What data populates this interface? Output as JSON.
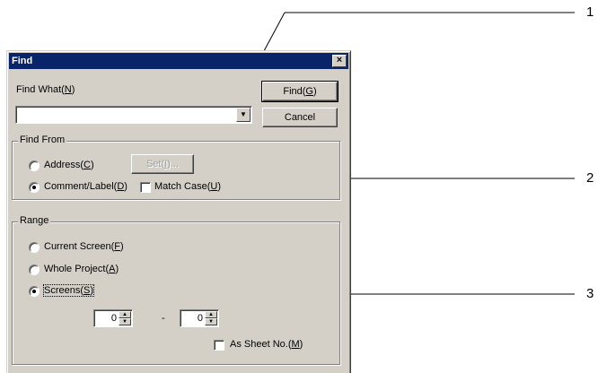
{
  "dialog": {
    "title": "Find",
    "close_glyph": "×",
    "find_what": {
      "label": "Find What(",
      "key": "N",
      "end": ")",
      "value": ""
    },
    "find_button": {
      "label": "Find(",
      "key": "G",
      "end": ")"
    },
    "cancel_button": {
      "label": "Cancel"
    },
    "find_from": {
      "title": "Find From",
      "address": {
        "label": "Address(",
        "key": "C",
        "end": ")",
        "selected": false
      },
      "set_button": {
        "label": "Set(",
        "key": "I",
        "end": ")..."
      },
      "comment": {
        "label": "Comment/Label(",
        "key": "D",
        "end": ")",
        "selected": true
      },
      "match_case": {
        "label": "Match Case(",
        "key": "U",
        "end": ")",
        "checked": false
      }
    },
    "range": {
      "title": "Range",
      "current": {
        "label": "Current Screen(",
        "key": "F",
        "end": ")",
        "selected": false
      },
      "whole": {
        "label": "Whole Project(",
        "key": "A",
        "end": ")",
        "selected": false
      },
      "screens": {
        "label": "Screens(",
        "key": "S",
        "end": ")",
        "selected": true
      },
      "from_value": "0",
      "dash": "-",
      "to_value": "0",
      "as_sheet": {
        "label": "As Sheet No.(",
        "key": "M",
        "end": ")",
        "checked": false
      }
    }
  },
  "annotations": [
    "1",
    "2",
    "3"
  ],
  "icons": {
    "close": "close-icon",
    "dropdown": "chevron-down-icon",
    "spin": "spin-arrows-icon"
  }
}
